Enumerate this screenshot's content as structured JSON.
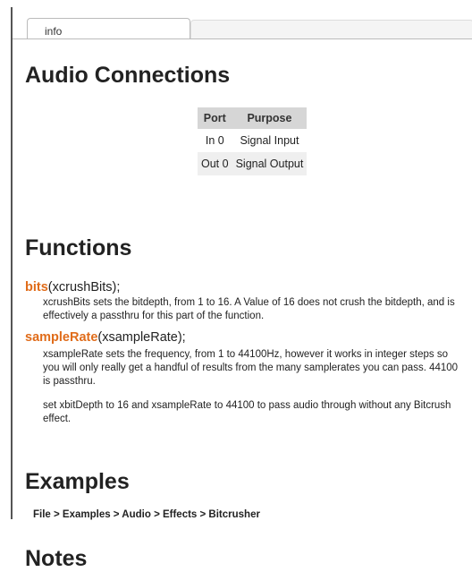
{
  "tab": {
    "label": "info"
  },
  "headings": {
    "audio_connections": "Audio Connections",
    "functions": "Functions",
    "examples": "Examples",
    "notes": "Notes"
  },
  "ports_table": {
    "headers": [
      "Port",
      "Purpose"
    ],
    "rows": [
      [
        "In 0",
        "Signal Input"
      ],
      [
        "Out 0",
        "Signal Output"
      ]
    ]
  },
  "functions": [
    {
      "name": "bits",
      "args": "(xcrushBits);",
      "description": "xcrushBits sets the bitdepth, from 1 to 16. A Value of 16 does not crush the bitdepth, and is effectively a passthru for this part of the function."
    },
    {
      "name": "sampleRate",
      "args": "(xsampleRate);",
      "description": "xsampleRate sets the frequency, from 1 to 44100Hz, however it works in integer steps so you will only really get a handful of results from the many samplerates you can pass. 44100 is passthru.",
      "note": "set xbitDepth to 16 and xsampleRate to 44100 to pass audio through without any Bitcrush effect."
    }
  ],
  "examples": {
    "path": "File > Examples > Audio > Effects > Bitcrusher"
  }
}
